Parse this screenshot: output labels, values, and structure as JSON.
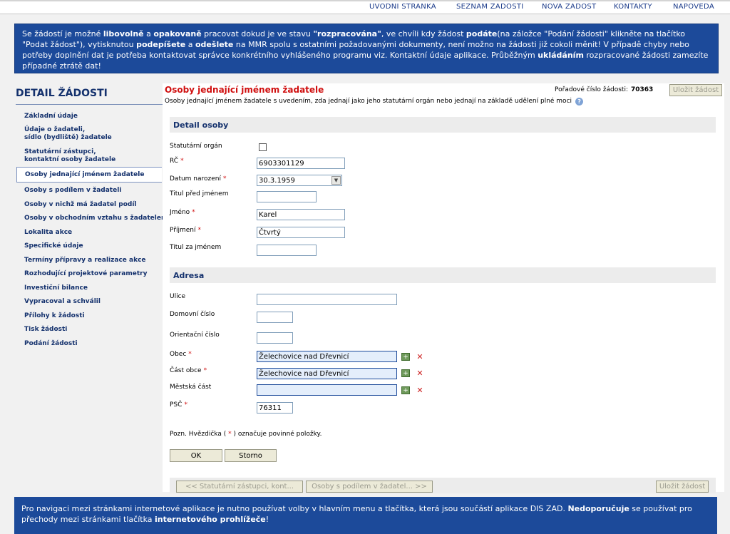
{
  "topnav": [
    "UVODNI STRANKA",
    "SEZNAM ZADOSTI",
    "NOVA ZADOST",
    "KONTAKTY",
    "NAPOVEDA"
  ],
  "info": {
    "p1": "Se žádostí je možné ",
    "b1": "libovolně",
    "p2": " a ",
    "b2": "opakovaně",
    "p3": " pracovat dokud je ve stavu ",
    "b3": "\"rozpracována\"",
    "p4": ", ve chvíli kdy žádost ",
    "b4": "podáte",
    "p5": "(na záložce \"Podání žádosti\" klikněte na tlačítko \"Podat žádost\"), vytisknutou ",
    "b5": "podepíšete",
    "p6": " a ",
    "b6": "odešlete",
    "p7": " na MMR spolu s ostatními požadovanými dokumenty, není možno na žádosti již cokoli měnit! V případě chyby nebo potřeby doplnění dat je potřeba kontaktovat správce konkrétního vyhlášeného programu viz. Kontaktní údaje aplikace. Průběžným ",
    "b7": "ukládáním",
    "p8": " rozpracované žádosti zamezíte případné ztrátě dat!"
  },
  "sidebar": {
    "title": "DETAIL ŽÁDOSTI",
    "items": [
      "Základní údaje",
      "Údaje o žadateli,",
      "sídlo (bydliště) žadatele",
      "Statutární zástupci,",
      "kontaktní osoby žadatele",
      "Osoby jednající jménem žadatele",
      "Osoby s podílem v žadateli",
      "Osoby v nichž má žadatel podíl",
      "Osoby v obchodním vztahu s žadatelem",
      "Lokalita akce",
      "Specifické údaje",
      "Termíny přípravy a realizace akce",
      "Rozhodující projektové parametry",
      "Investiční bilance",
      "Vypracoval a schválil",
      "Přílohy k žádosti",
      "Tisk žádosti",
      "Podání žádosti"
    ]
  },
  "main": {
    "title": "Osoby jednající jménem žadatele",
    "subtitle": "Osoby jednající jménem žadatele s uvedením, zda jednají jako jeho statutární orgán nebo jednají na základě udělení plné moci",
    "app_number_label": "Pořadové číslo žádosti:",
    "app_number": "70363",
    "save_label": "Uložit žádost"
  },
  "detail": {
    "heading": "Detail osoby",
    "statutory_label": "Statutární orgán",
    "rc_label": "RČ",
    "rc_value": "6903301129",
    "dob_label": "Datum narození",
    "dob_value": "30.3.1959",
    "title_before_label": "Titul před jménem",
    "title_before_value": "",
    "first_name_label": "Jméno",
    "first_name_value": "Karel",
    "last_name_label": "Příjmení",
    "last_name_value": "Čtvrtý",
    "title_after_label": "Titul za jménem",
    "title_after_value": ""
  },
  "address": {
    "heading": "Adresa",
    "street_label": "Ulice",
    "street_value": "",
    "house_no_label": "Domovní číslo",
    "house_no_value": "",
    "orient_no_label": "Orientační číslo",
    "orient_no_value": "",
    "municipality_label": "Obec",
    "municipality_value": "Želechovice nad Dřevnicí",
    "municipality_part_label": "Část obce",
    "municipality_part_value": "Želechovice nad Dřevnicí",
    "city_district_label": "Městská část",
    "city_district_value": "",
    "zip_label": "PSČ",
    "zip_value": "76311"
  },
  "note": {
    "before": "Pozn. Hvězdička ( ",
    "star": "*",
    "after": " ) označuje povinné položky."
  },
  "buttons": {
    "ok": "OK",
    "cancel": "Storno",
    "prev": "<< Statutární zástupci, kont...",
    "next": "Osoby s podílem v žadatel... >>",
    "save_bottom": "Uložit žádost"
  },
  "bottom_info": {
    "p1": "Pro navigaci mezi stránkami internetové aplikace je nutno používat volby v hlavním menu a tlačítka, která jsou součástí aplikace DIS ZAD. ",
    "b1": "Nedoporučuje",
    "p2": " se používat pro přechody mezi stránkami tlačítka ",
    "b2": "internetového prohlížeče",
    "p3": "!"
  },
  "required_mark": "*"
}
